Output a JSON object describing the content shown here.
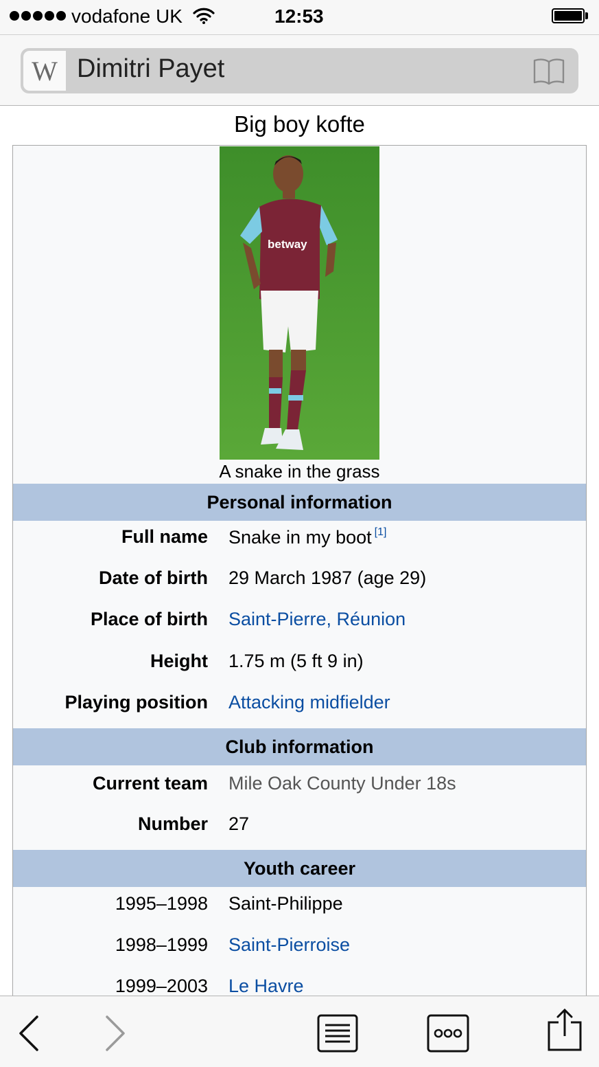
{
  "status_bar": {
    "carrier": "vodafone UK",
    "time": "12:53",
    "icons": [
      "signal-dots-icon",
      "wifi-icon",
      "battery-icon"
    ]
  },
  "nav": {
    "site_logo": "W",
    "page_title": "Dimitri Payet",
    "icons": [
      "wikipedia-logo-icon",
      "book-icon"
    ]
  },
  "content": {
    "title": "Big boy kofte",
    "image_caption": "A snake in the grass",
    "sections": [
      {
        "header": "Personal information",
        "rows": [
          {
            "label": "Full name",
            "value": "Snake in my boot",
            "ref": "[1]"
          },
          {
            "label": "Date of birth",
            "value": "29 March 1987 (age 29)"
          },
          {
            "label": "Place of birth",
            "value": "Saint-Pierre, Réunion"
          },
          {
            "label": "Height",
            "value": "1.75 m (5 ft 9 in)"
          },
          {
            "label": "Playing position",
            "value": "Attacking midfielder"
          }
        ]
      },
      {
        "header": "Club information",
        "rows": [
          {
            "label": "Current team",
            "value": "Mile Oak County Under 18s"
          },
          {
            "label": "Number",
            "value": "27"
          }
        ]
      },
      {
        "header": "Youth career",
        "rows": [
          {
            "label": "1995–1998",
            "value": "Saint-Philippe"
          },
          {
            "label": "1998–1999",
            "value": "Saint-Pierroise"
          },
          {
            "label": "1999–2003",
            "value": "Le Havre"
          }
        ]
      }
    ],
    "colors": {
      "link": "#0b4ea2",
      "section_header": "#b0c4de",
      "infobox_bg": "#f8f9fa"
    }
  },
  "toolbar": {
    "icons": [
      "back-chevron-icon",
      "forward-chevron-icon",
      "table-of-contents-icon",
      "more-options-icon",
      "share-icon"
    ]
  }
}
